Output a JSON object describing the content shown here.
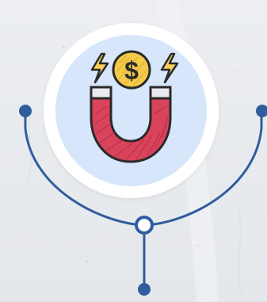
{
  "illustration": {
    "subject": "money-magnet",
    "currency_symbol": "$",
    "icons": [
      "magnet-icon",
      "dollar-coin-icon",
      "lightning-bolt-icon"
    ]
  },
  "colors": {
    "background": "#e7eaee",
    "circle_outer": "#ffffff",
    "circle_inner": "#d7e6fb",
    "connector_line": "#2f5d9e",
    "connector_node_fill": "#ffffff",
    "magnet_red": "#d9435b",
    "magnet_tips": "#e9e9ef",
    "coin_gold": "#f5c94a",
    "bolt_yellow": "#f6d05a",
    "outline": "#2a2a2a"
  }
}
